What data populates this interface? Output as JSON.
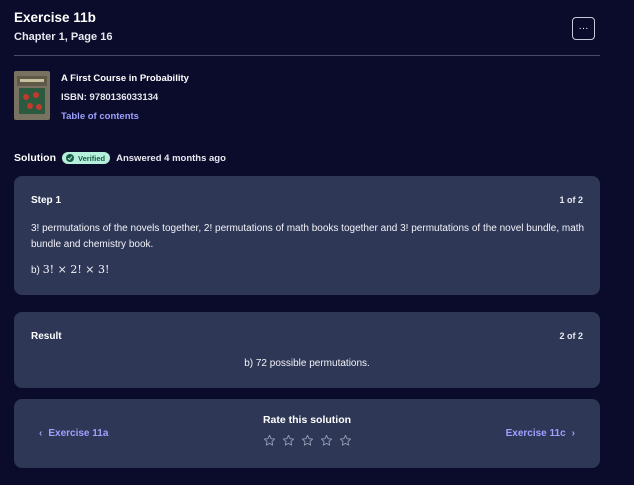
{
  "header": {
    "title": "Exercise 11b",
    "subtitle": "Chapter 1, Page 16",
    "more_label": "···"
  },
  "book": {
    "title": "A First Course in Probability",
    "isbn": "ISBN: 9780136033134",
    "toc_label": "Table of contents"
  },
  "solution": {
    "label": "Solution",
    "badge": "Verified",
    "answered": "Answered 4 months ago"
  },
  "step": {
    "title": "Step 1",
    "count": "1 of 2",
    "text": "3! permutations of the novels together, 2! permutations of math books together and 3! permutations of the novel bundle, math bundle and chemistry book.",
    "formula_prefix": "b)",
    "formula": "3! × 2! × 3!"
  },
  "result": {
    "title": "Result",
    "count": "2 of 2",
    "text": "b) 72 possible permutations."
  },
  "nav": {
    "prev_label": "Exercise 11a",
    "next_label": "Exercise 11c",
    "rate_label": "Rate this solution",
    "stars": 5
  },
  "colors": {
    "background": "#0b0b2b",
    "card": "#2e3856",
    "link": "#9ea0ff",
    "verified_bg": "#b4f0dc"
  }
}
